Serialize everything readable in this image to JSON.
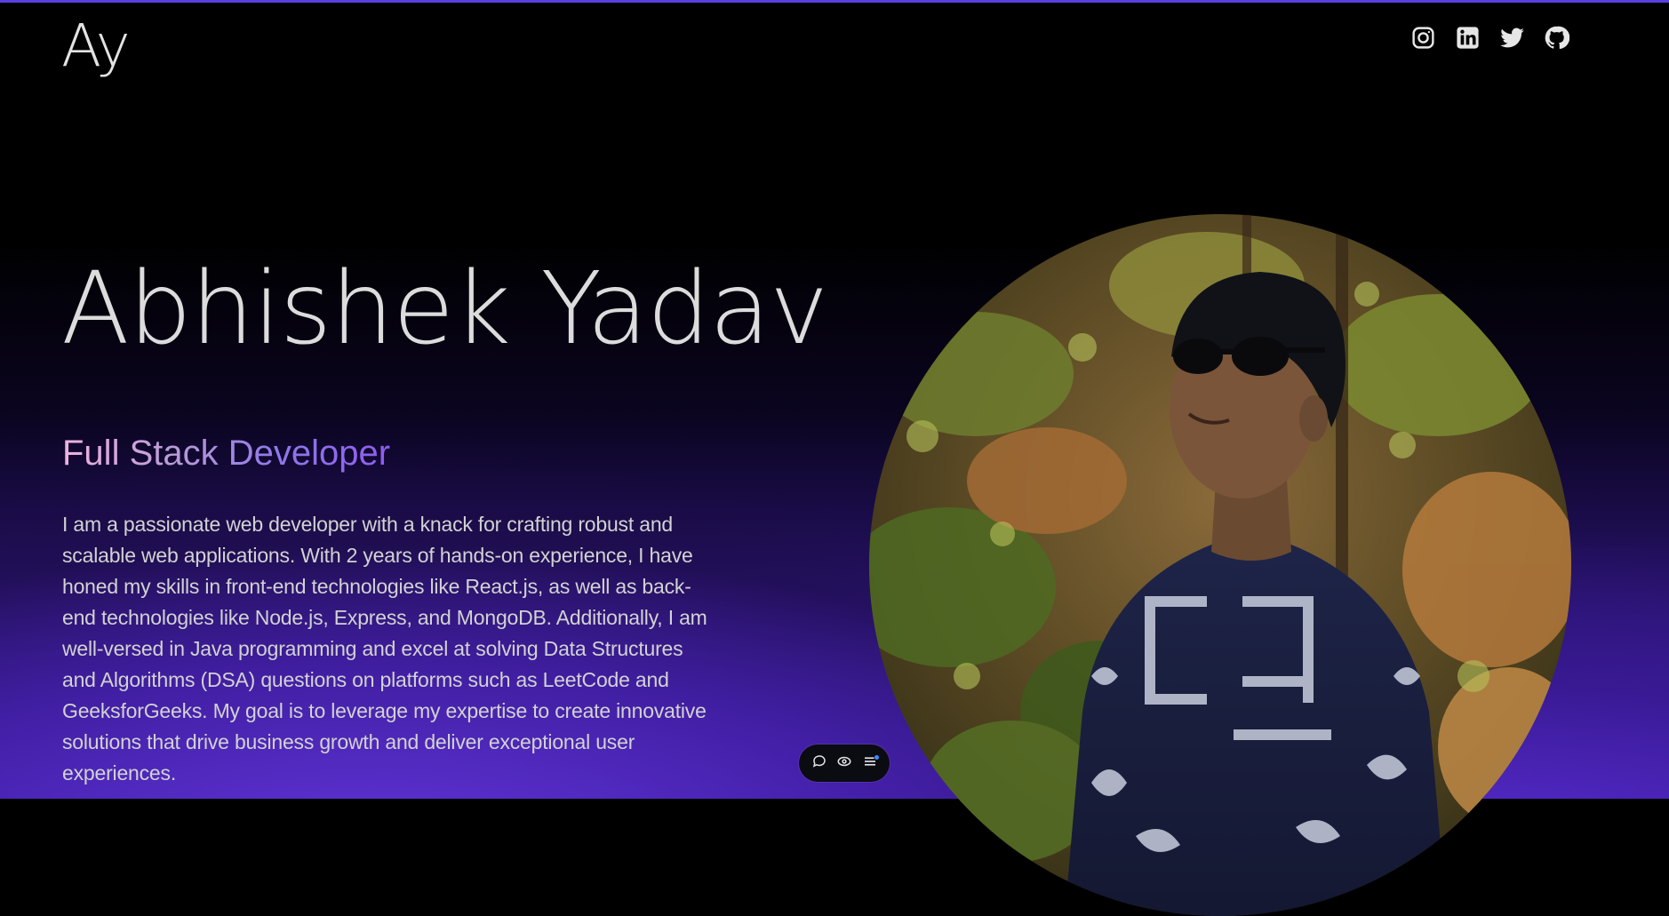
{
  "header": {
    "logo_text": "Ay",
    "socials": [
      {
        "name": "Instagram",
        "icon": "instagram-icon"
      },
      {
        "name": "LinkedIn",
        "icon": "linkedin-icon"
      },
      {
        "name": "Twitter",
        "icon": "twitter-icon"
      },
      {
        "name": "GitHub",
        "icon": "github-icon"
      }
    ]
  },
  "hero": {
    "name": "Abhishek Yadav",
    "role": "Full Stack Developer",
    "bio": "I am a passionate web developer with a knack for crafting robust and scalable web applications. With 2 years of hands-on experience, I have honed my skills in front-end technologies like React.js, as well as back-end technologies like Node.js, Express, and MongoDB. Additionally, I am well-versed in Java programming and excel at solving Data Structures and Algorithms (DSA) questions on platforms such as LeetCode and GeeksforGeeks. My goal is to leverage my expertise to create innovative solutions that drive business growth and deliver exceptional user experiences."
  },
  "toolbar": {
    "icons": [
      "comment-icon",
      "eye-icon",
      "menu-icon"
    ]
  },
  "colors": {
    "accent": "#5b3fe0",
    "background_top": "#000000",
    "background_bottom": "#4424b8",
    "role_gradient_start": "#f0b3e0",
    "role_gradient_end": "#8e5cf0",
    "text": "#d8d8d8"
  }
}
